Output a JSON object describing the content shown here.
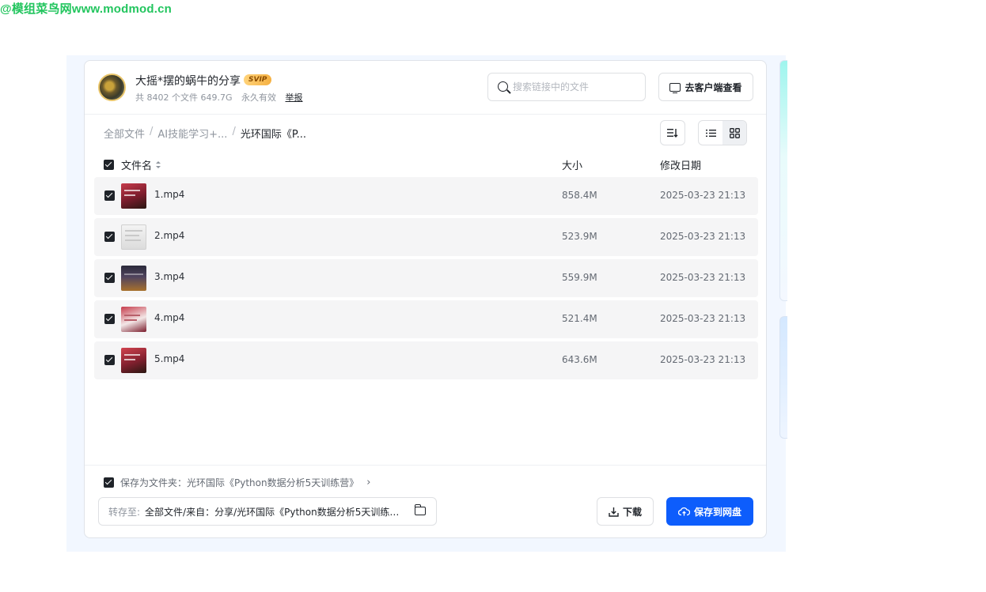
{
  "watermark": "@模组菜鸟网www.modmod.cn",
  "share": {
    "title": "大摇*摆的蜗牛的分享",
    "badge": "SVIP",
    "file_count": "共 8402 个文件 649.7G",
    "validity": "永久有效",
    "report": "举报"
  },
  "search": {
    "placeholder": "搜索链接中的文件"
  },
  "client_button": "去客户端查看",
  "breadcrumb": {
    "root": "全部文件",
    "sep": "/",
    "level1": "AI技能学习+...",
    "current": "光环国际《P..."
  },
  "table": {
    "col_name": "文件名",
    "col_size": "大小",
    "col_date": "修改日期",
    "rows": [
      {
        "name": "1.mp4",
        "size": "858.4M",
        "date": "2025-03-23 21:13"
      },
      {
        "name": "2.mp4",
        "size": "523.9M",
        "date": "2025-03-23 21:13"
      },
      {
        "name": "3.mp4",
        "size": "559.9M",
        "date": "2025-03-23 21:13"
      },
      {
        "name": "4.mp4",
        "size": "521.4M",
        "date": "2025-03-23 21:13"
      },
      {
        "name": "5.mp4",
        "size": "643.6M",
        "date": "2025-03-23 21:13"
      }
    ]
  },
  "footer": {
    "save_as_folder": "保存为文件夹：光环国际《Python数据分析5天训练营》",
    "dest_label": "转存至:",
    "dest_path": "全部文件/来自：分享/光环国际《Python数据分析5天训练营》",
    "download": "下载",
    "save": "保存到网盘"
  },
  "colors": {
    "primary": "#0d5dfc",
    "row_bg": "#f5f5f6",
    "badge": "#f5b041"
  }
}
